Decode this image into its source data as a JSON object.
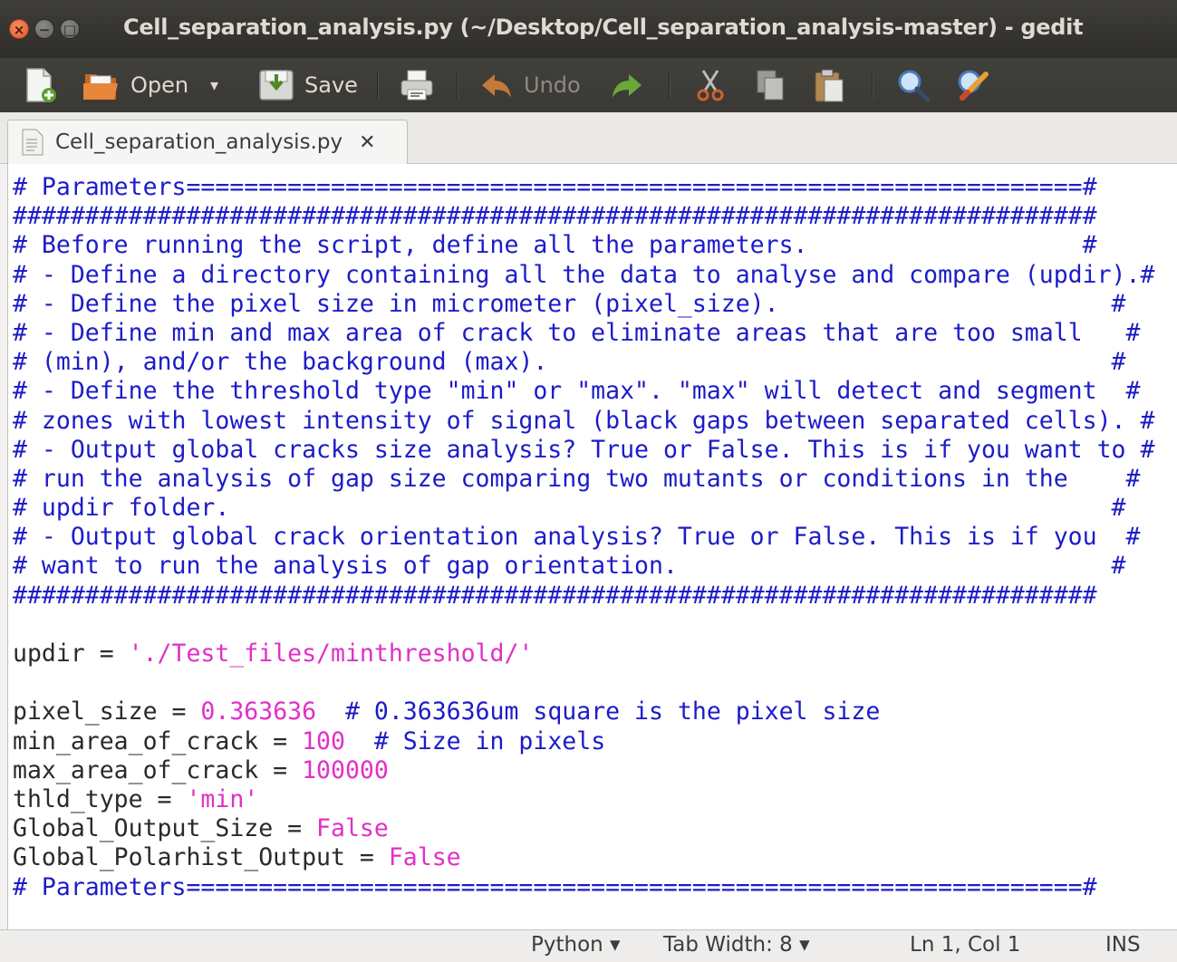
{
  "window": {
    "title": "Cell_separation_analysis.py (~/Desktop/Cell_separation_analysis-master) - gedit",
    "buttons": {
      "close": "×",
      "minimize": "−",
      "maximize": "□"
    }
  },
  "toolbar": {
    "new_icon": "new-document-icon",
    "open_label": "Open",
    "open_dropdown": "▾",
    "save_label": "Save",
    "print_icon": "print-icon",
    "undo_label": "Undo",
    "redo_icon": "redo-icon",
    "cut_icon": "cut-icon",
    "copy_icon": "copy-icon",
    "paste_icon": "paste-icon",
    "find_icon": "search-icon",
    "replace_icon": "find-replace-icon"
  },
  "tab": {
    "label": "Cell_separation_analysis.py",
    "close": "✕"
  },
  "code_lines": [
    [
      {
        "t": "# Parameters==============================================================#",
        "c": "comment"
      }
    ],
    [
      {
        "t": "###########################################################################",
        "c": "comment"
      }
    ],
    [
      {
        "t": "# Before running the script, define all the parameters.                   #",
        "c": "comment"
      }
    ],
    [
      {
        "t": "# - Define a directory containing all the data to analyse and compare (updir).#",
        "c": "comment"
      }
    ],
    [
      {
        "t": "# - Define the pixel size in micrometer (pixel_size).                       #",
        "c": "comment"
      }
    ],
    [
      {
        "t": "# - Define min and max area of crack to eliminate areas that are too small   #",
        "c": "comment"
      }
    ],
    [
      {
        "t": "# (min), and/or the background (max).                                       #",
        "c": "comment"
      }
    ],
    [
      {
        "t": "# - Define the threshold type \"min\" or \"max\". \"max\" will detect and segment  #",
        "c": "comment"
      }
    ],
    [
      {
        "t": "# zones with lowest intensity of signal (black gaps between separated cells). #",
        "c": "comment"
      }
    ],
    [
      {
        "t": "# - Output global cracks size analysis? True or False. This is if you want to #",
        "c": "comment"
      }
    ],
    [
      {
        "t": "# run the analysis of gap size comparing two mutants or conditions in the    #",
        "c": "comment"
      }
    ],
    [
      {
        "t": "# updir folder.                                                             #",
        "c": "comment"
      }
    ],
    [
      {
        "t": "# - Output global crack orientation analysis? True or False. This is if you  #",
        "c": "comment"
      }
    ],
    [
      {
        "t": "# want to run the analysis of gap orientation.                              #",
        "c": "comment"
      }
    ],
    [
      {
        "t": "###########################################################################",
        "c": "comment"
      }
    ],
    [
      {
        "t": "",
        "c": "plain"
      }
    ],
    [
      {
        "t": "updir = ",
        "c": "plain"
      },
      {
        "t": "'./Test_files/minthreshold/'",
        "c": "str"
      }
    ],
    [
      {
        "t": "",
        "c": "plain"
      }
    ],
    [
      {
        "t": "pixel_size = ",
        "c": "plain"
      },
      {
        "t": "0.363636",
        "c": "num"
      },
      {
        "t": "  # 0.363636um square is the pixel size",
        "c": "comment"
      }
    ],
    [
      {
        "t": "min_area_of_crack = ",
        "c": "plain"
      },
      {
        "t": "100",
        "c": "num"
      },
      {
        "t": "  # Size in pixels",
        "c": "comment"
      }
    ],
    [
      {
        "t": "max_area_of_crack = ",
        "c": "plain"
      },
      {
        "t": "100000",
        "c": "num"
      }
    ],
    [
      {
        "t": "thld_type = ",
        "c": "plain"
      },
      {
        "t": "'min'",
        "c": "str"
      }
    ],
    [
      {
        "t": "Global_Output_Size = ",
        "c": "plain"
      },
      {
        "t": "False",
        "c": "kw"
      }
    ],
    [
      {
        "t": "Global_Polarhist_Output = ",
        "c": "plain"
      },
      {
        "t": "False",
        "c": "kw"
      }
    ],
    [
      {
        "t": "# Parameters==============================================================#",
        "c": "comment"
      }
    ]
  ],
  "statusbar": {
    "language": "Python ▾",
    "tab_width": "Tab Width: 8 ▾",
    "position": "Ln 1, Col 1",
    "mode": "INS"
  },
  "colors": {
    "comment": "#1c1cc8",
    "string": "#e030c8",
    "titlebar": "#3c3b37"
  }
}
